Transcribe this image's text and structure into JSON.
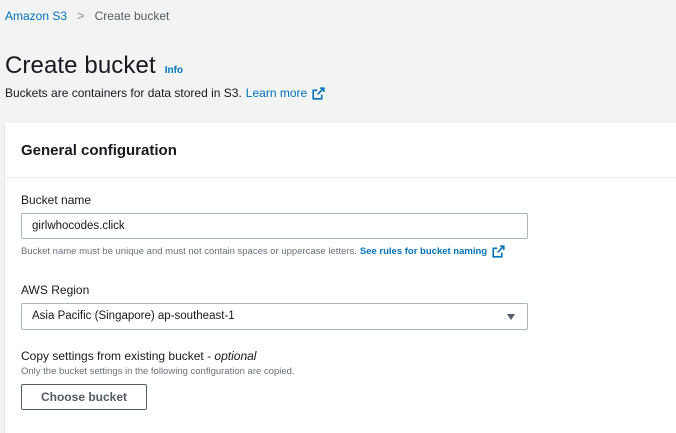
{
  "breadcrumb": {
    "root": "Amazon S3",
    "separator": ">",
    "current": "Create bucket"
  },
  "header": {
    "title": "Create bucket",
    "info_label": "Info",
    "description": "Buckets are containers for data stored in S3.",
    "learn_more": "Learn more"
  },
  "general_configuration": {
    "title": "General configuration",
    "bucket_name": {
      "label": "Bucket name",
      "value": "girlwhocodes.click",
      "hint": "Bucket name must be unique and must not contain spaces or uppercase letters.",
      "rules_link": "See rules for bucket naming"
    },
    "region": {
      "label": "AWS Region",
      "selected": "Asia Pacific (Singapore) ap-southeast-1"
    },
    "copy_settings": {
      "label": "Copy settings from existing bucket - ",
      "label_optional": "optional",
      "hint": "Only the bucket settings in the following configuration are copied.",
      "button": "Choose bucket"
    }
  },
  "icons": {
    "external_link": "external-link-icon",
    "dropdown": "caret-down-icon"
  },
  "colors": {
    "link": "#0073bb",
    "background": "#f2f3f3",
    "text": "#16191f",
    "muted": "#687078"
  }
}
